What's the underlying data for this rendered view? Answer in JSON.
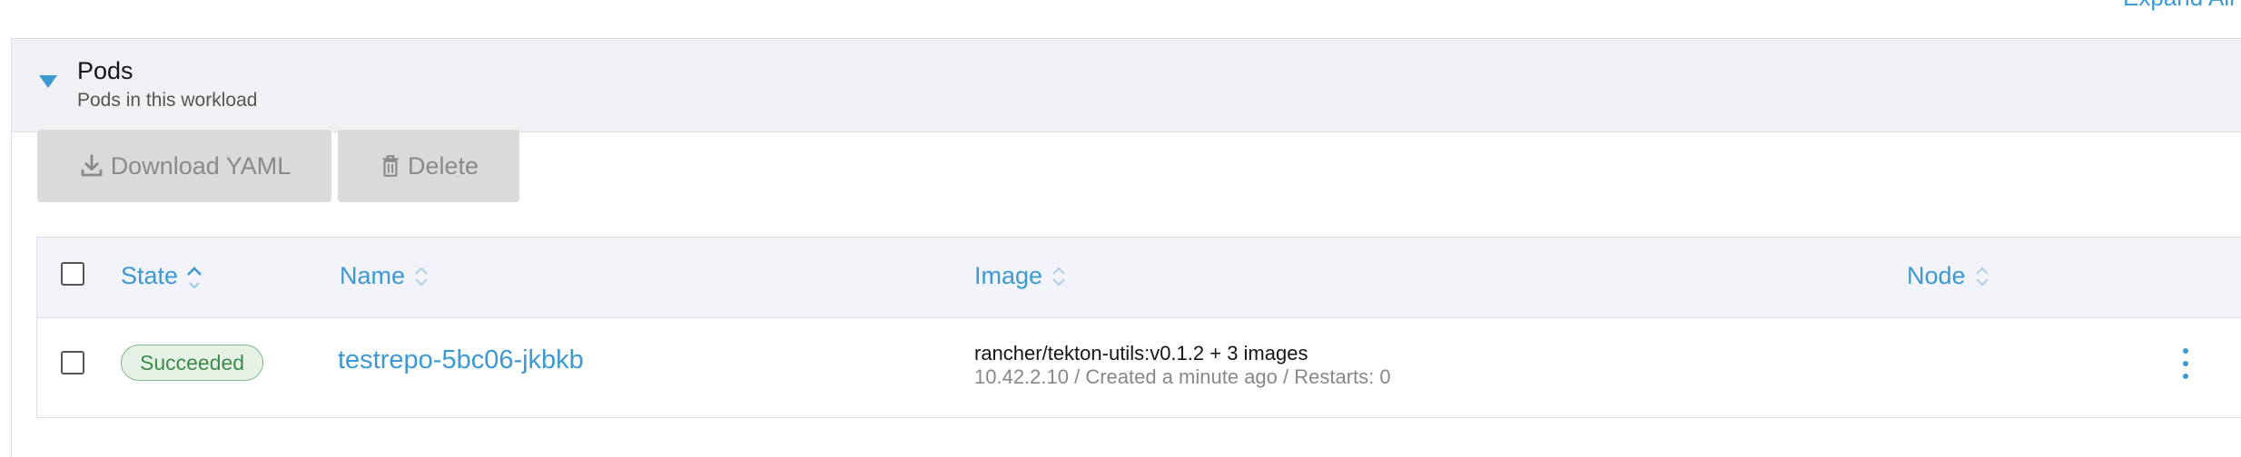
{
  "top": {
    "expand_all": "Expand All"
  },
  "section": {
    "title": "Pods",
    "subtitle": "Pods in this workload"
  },
  "toolbar": {
    "download_label": "Download YAML",
    "delete_label": "Delete",
    "download_icon": "download-icon",
    "delete_icon": "trash-icon"
  },
  "table": {
    "columns": [
      "State",
      "Name",
      "Image",
      "Node"
    ],
    "rows": [
      {
        "state": "Succeeded",
        "name": "testrepo-5bc06-jkbkb",
        "image": "rancher/tekton-utils:v0.1.2 + 3 images",
        "image_detail": "10.42.2.10 / Created a minute ago / Restarts: 0",
        "node": ""
      }
    ]
  },
  "colors": {
    "accent": "#3d98d3",
    "success_bg": "#e6f2e6",
    "success_text": "#3d8a4b"
  }
}
